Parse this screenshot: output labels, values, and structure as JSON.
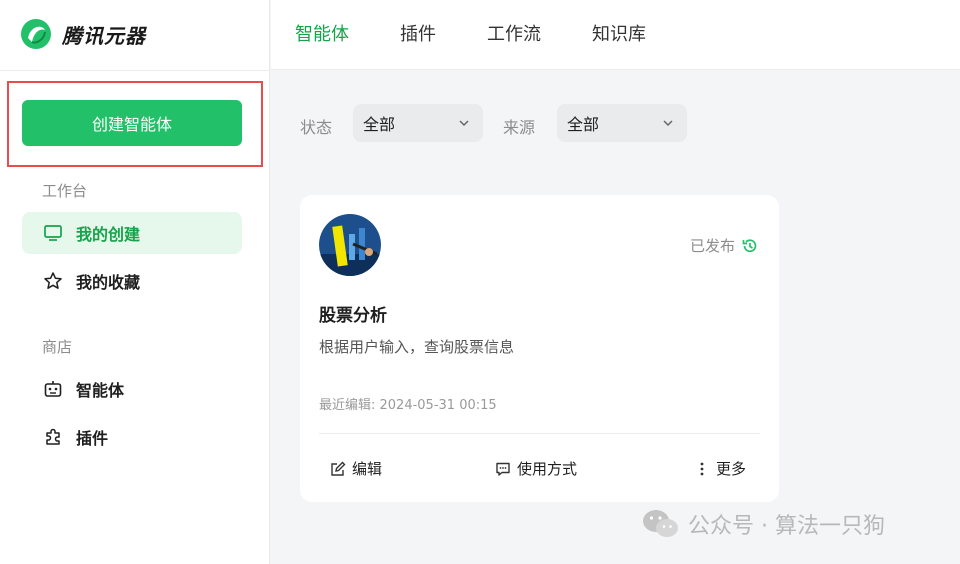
{
  "app": {
    "name": "腾讯元器",
    "brand_color": "#22c069"
  },
  "sidebar": {
    "create_button": "创建智能体",
    "sections": [
      {
        "label": "工作台",
        "items": [
          {
            "label": "我的创建",
            "icon": "monitor-icon",
            "active": true
          },
          {
            "label": "我的收藏",
            "icon": "star-icon",
            "active": false
          }
        ]
      },
      {
        "label": "商店",
        "items": [
          {
            "label": "智能体",
            "icon": "robot-icon",
            "active": false
          },
          {
            "label": "插件",
            "icon": "puzzle-icon",
            "active": false
          }
        ]
      }
    ]
  },
  "tabs": [
    {
      "label": "智能体",
      "active": true
    },
    {
      "label": "插件",
      "active": false
    },
    {
      "label": "工作流",
      "active": false
    },
    {
      "label": "知识库",
      "active": false
    }
  ],
  "filters": [
    {
      "label": "状态",
      "value": "全部"
    },
    {
      "label": "来源",
      "value": "全部"
    }
  ],
  "card": {
    "title": "股票分析",
    "description": "根据用户输入，查询股票信息",
    "status": "已发布",
    "meta": "最近编辑: 2024-05-31 00:15",
    "actions": {
      "edit": "编辑",
      "usage": "使用方式",
      "more": "更多"
    }
  },
  "watermark": "公众号 · 算法一只狗"
}
